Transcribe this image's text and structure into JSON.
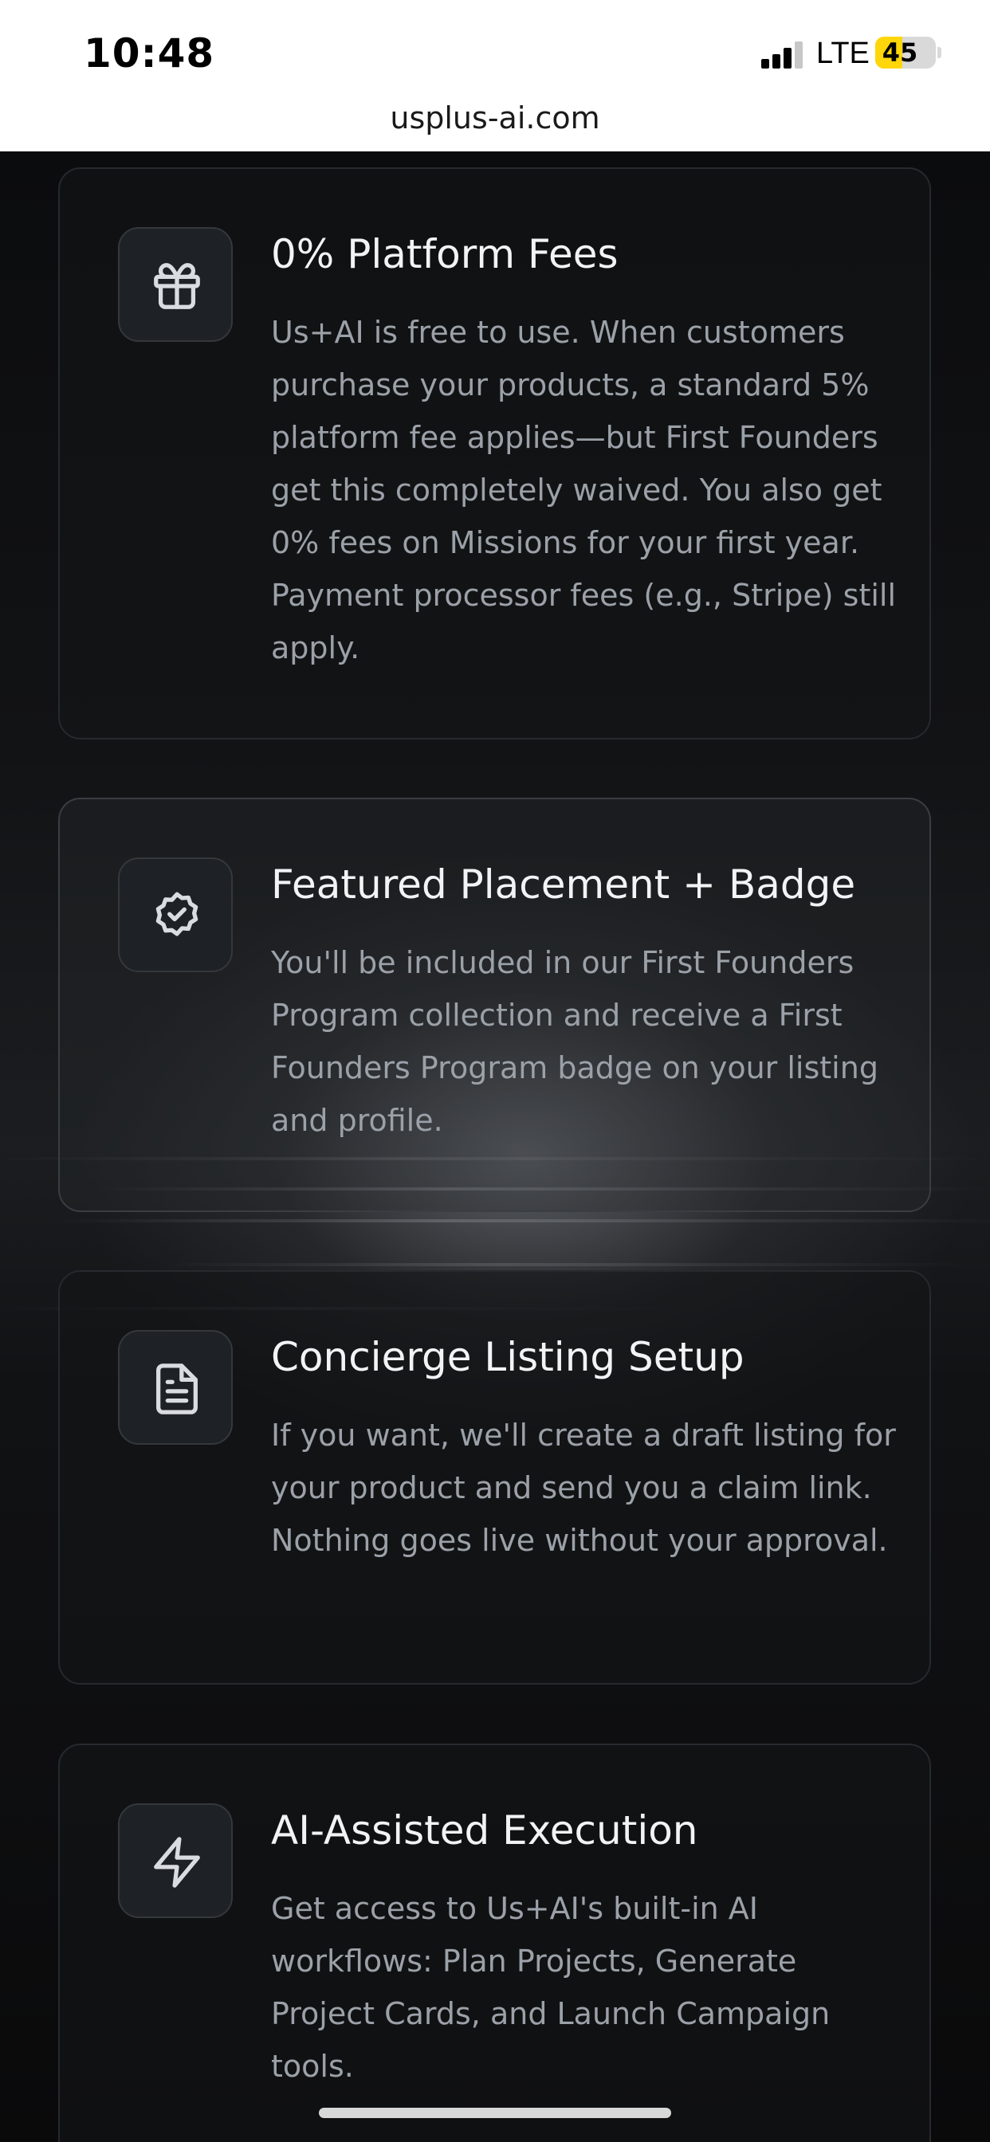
{
  "status_bar": {
    "time": "10:48",
    "network": "LTE",
    "battery_level": "45",
    "battery_color": "#ffd60a"
  },
  "browser": {
    "url": "usplus-ai.com"
  },
  "cards": [
    {
      "icon": "gift-icon",
      "title": "0% Platform Fees",
      "description": "Us+AI is free to use. When customers purchase your products, a standard 5% platform fee applies—but First Founders get this completely waived. You also get 0% fees on Missions for your first year. Payment processor fees (e.g., Stripe) still apply."
    },
    {
      "icon": "badge-check-icon",
      "title": "Featured Placement + Badge",
      "description": "You'll be included in our First Founders Program collection and receive a First Founders Program badge on your listing and profile."
    },
    {
      "icon": "document-icon",
      "title": "Concierge Listing Setup",
      "description": "If you want, we'll create a draft listing for your product and send you a claim link. Nothing goes live without your approval."
    },
    {
      "icon": "lightning-icon",
      "title": "AI-Assisted Execution",
      "description": "Get access to Us+AI's built-in AI workflows: Plan Projects, Generate Project Cards, and Launch Campaign tools."
    }
  ]
}
